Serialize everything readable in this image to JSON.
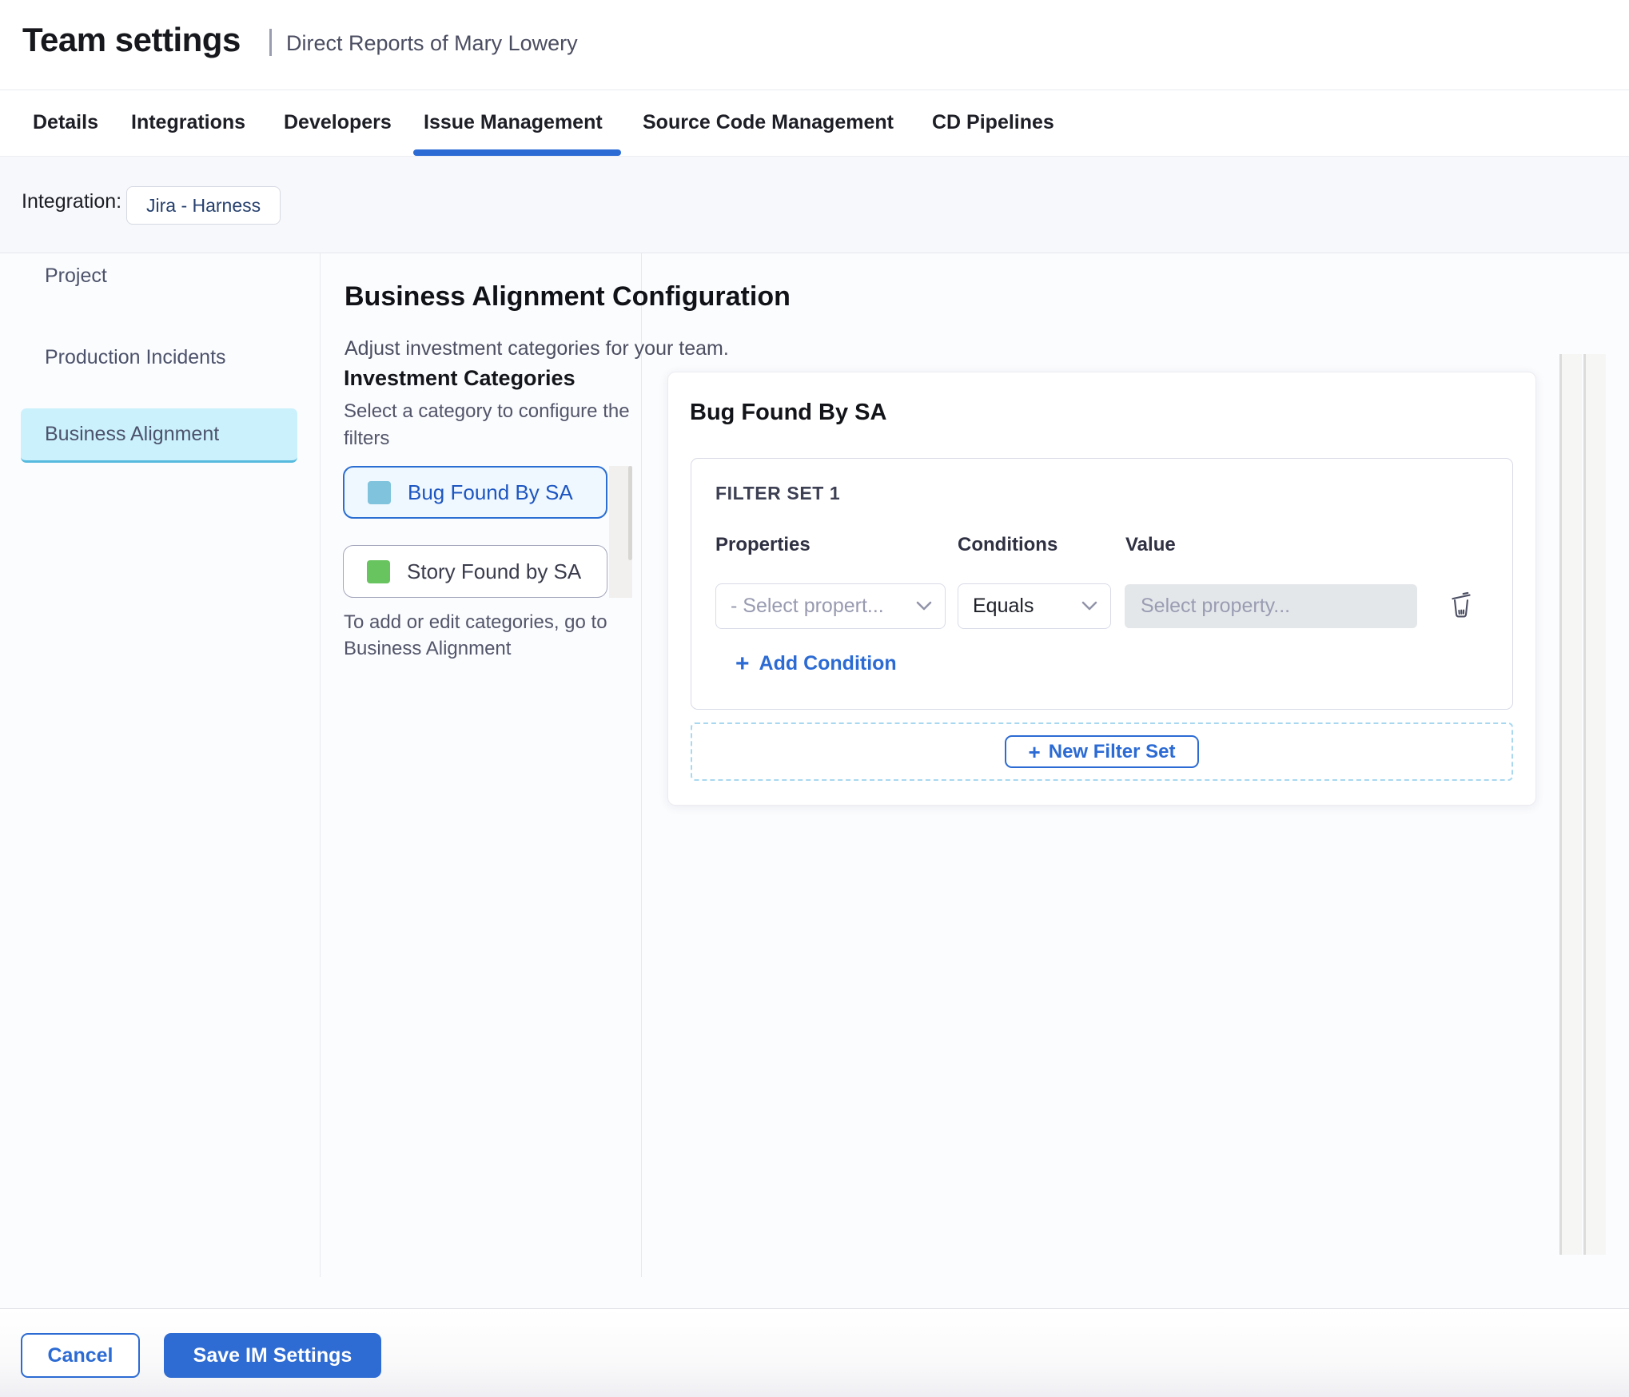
{
  "header": {
    "title": "Team settings",
    "subtitle": "Direct Reports of Mary Lowery"
  },
  "tabs": [
    {
      "label": "Details",
      "active": false
    },
    {
      "label": "Integrations",
      "active": false
    },
    {
      "label": "Developers",
      "active": false
    },
    {
      "label": "Issue Management",
      "active": true
    },
    {
      "label": "Source Code Management",
      "active": false
    },
    {
      "label": "CD Pipelines",
      "active": false
    }
  ],
  "integration": {
    "label": "Integration:",
    "value": "Jira - Harness"
  },
  "sidebar": {
    "items": [
      {
        "label": "Project",
        "active": false
      },
      {
        "label": "Production Incidents",
        "active": false
      },
      {
        "label": "Business Alignment",
        "active": true
      }
    ]
  },
  "main": {
    "title": "Business Alignment Configuration",
    "subtitle": "Adjust investment categories for your team.",
    "categories": {
      "heading": "Investment Categories",
      "help": "Select a category to configure the filters",
      "items": [
        {
          "label": "Bug Found By SA",
          "swatch_color": "#7fc3dc",
          "selected": true
        },
        {
          "label": "Story Found by SA",
          "swatch_color": "#68c45e",
          "selected": false
        }
      ],
      "note": "To add or edit categories, go to Business Alignment"
    }
  },
  "panel": {
    "title": "Bug Found By SA",
    "filter_set": {
      "label": "FILTER SET 1",
      "columns": {
        "properties": "Properties",
        "conditions": "Conditions",
        "value": "Value"
      },
      "property_placeholder": "- Select propert...",
      "condition_value": "Equals",
      "value_placeholder": "Select property...",
      "add_condition_label": "Add Condition",
      "plus": "+"
    },
    "new_filter_set_label": "New Filter Set"
  },
  "footer": {
    "cancel_label": "Cancel",
    "save_label": "Save IM Settings"
  },
  "icons": {
    "trash": "trash-icon",
    "chevron": "chevron-down-icon"
  },
  "colors": {
    "primary_blue": "#2c6bd4",
    "save_button_blue": "#2e6bd2",
    "active_tab_underline": "#2c6bd4",
    "sidebar_active_bg": "#cbf1fd",
    "sidebar_active_border": "#55bade",
    "category_selected_bg": "#f0f8ff",
    "category_selected_border": "#2a6ed3",
    "category_selected_text": "#1d56c1",
    "bug_swatch": "#7fc3dc",
    "story_swatch": "#68c45e",
    "chip_text": "#26406e",
    "dashed_zone_border": "#a8d8f0",
    "value_input_bg": "#e4e7ea",
    "integration_bar_bg": "#f6f8fb",
    "page_bg": "#fbfcfe"
  }
}
